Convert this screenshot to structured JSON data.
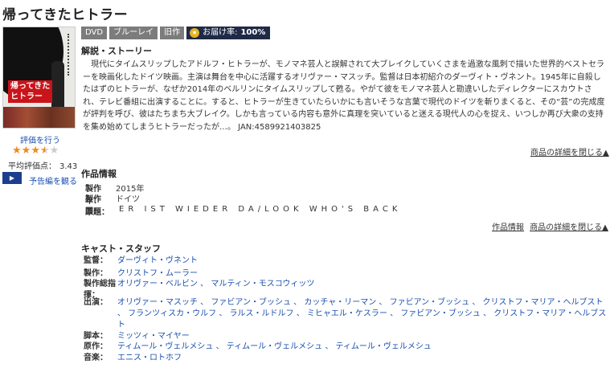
{
  "page": {
    "title": "帰ってきたヒトラー"
  },
  "cover": {
    "title_text": "帰ってきた\nヒトラー"
  },
  "sidebar": {
    "rate_link": "評価を行う",
    "stars": {
      "value": 3.5,
      "max": 5
    },
    "avg_label": "平均評価点：",
    "avg_value": "3.43",
    "play_label": "▶",
    "trailer_link": "予告編を観る"
  },
  "badges": {
    "dvd": "DVD",
    "bluray": "ブルーレイ",
    "old": "旧作",
    "delivery_label": "お届け率:",
    "delivery_value": "100%"
  },
  "synopsis": {
    "heading": "解説・ストーリー",
    "text": "現代にタイムスリップしたアドルフ・ヒトラーが、モノマネ芸人と誤解されて大ブレイクしていくさまを過激な風刺で描いた世界的ベストセラーを映画化したドイツ映画。主演は舞台を中心に活躍するオリヴァー・マスッチ。監督は日本初紹介のダーヴィト・ヴネント。1945年に自殺したはずのヒトラーが、なぜか2014年のベルリンにタイムスリップして甦る。やがて彼をモノマネ芸人と勘違いしたディレクターにスカウトされ、テレビ番組に出演することに。すると、ヒトラーが生きていたらいかにも言いそうな言葉で現代のドイツを斬りまくると、その“芸”の完成度が評判を呼び、彼はたちまち大ブレイク。しかも言っている内容も意外に真理を突いていると迷える現代人の心を捉え、いつしか再び大衆の支持を集め始めてしまうヒトラーだったが…。 JAN:4589921403825",
    "close_link": "商品の詳細を閉じる▲"
  },
  "info": {
    "heading": "作品情報",
    "rows": [
      {
        "key": "製作年：",
        "value": "2015年"
      },
      {
        "key": "製作国：",
        "value": "ドイツ"
      },
      {
        "key": "原題：",
        "value": "ER IST WIEDER DA/LOOK WHO'S BACK"
      }
    ],
    "link_info": "作品情報",
    "close_link": "商品の詳細を閉じる▲"
  },
  "cast": {
    "heading": "キャスト・スタッフ",
    "rows": [
      {
        "key": "監督：",
        "value": "ダーヴィト・ヴネント"
      },
      {
        "key": "製作：",
        "value": "クリストフ・ムーラー"
      },
      {
        "key": "製作総指揮：",
        "value": "オリヴァー・ベルビン 、 マルティン・モスコウィッツ"
      },
      {
        "key": "出演：",
        "value": "オリヴァー・マスッチ 、 ファビアン・ブッシュ 、 カッチャ・リーマン 、 ファビアン・ブッシュ 、 クリストフ・マリア・ヘルブスト 、 フランツィスカ・ウルフ 、 ラルス・ルドルフ 、 ミヒャエル・ケスラー 、 ファビアン・ブッシュ 、 クリストフ・マリア・ヘルブスト"
      },
      {
        "key": "脚本：",
        "value": "ミッツィ・マイヤー"
      },
      {
        "key": "原作：",
        "value": "ティムール・ヴェルメシュ 、 ティムール・ヴェルメシュ 、 ティムール・ヴェルメシュ"
      },
      {
        "key": "音楽：",
        "value": "エニス・ロトホフ"
      }
    ]
  }
}
